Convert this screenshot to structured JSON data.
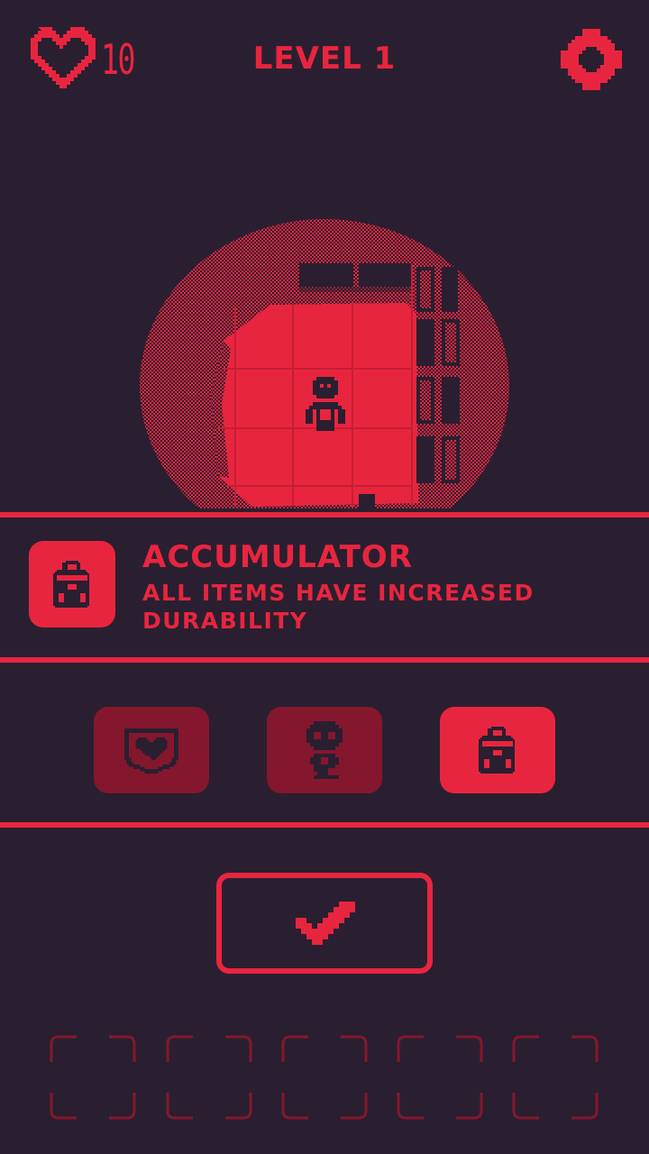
{
  "hud": {
    "lives": "10",
    "level_label": "LEVEL 1",
    "heart_icon": "heart-icon",
    "settings_icon": "gear-icon"
  },
  "selected_perk": {
    "title": "ACCUMULATOR",
    "description": "ALL ITEMS HAVE INCREASED DURABILITY",
    "icon": "backpack-icon"
  },
  "perk_choices": [
    {
      "icon": "heart-shield-icon",
      "selected": false
    },
    {
      "icon": "skull-icon",
      "selected": false
    },
    {
      "icon": "backpack-icon",
      "selected": true
    }
  ],
  "confirm": {
    "icon": "checkmark-icon"
  },
  "inventory": {
    "slot_count": 5,
    "filled": 0
  },
  "colors": {
    "background": "#2a1f30",
    "accent": "#e8253f",
    "accent_dim": "#84172d"
  }
}
